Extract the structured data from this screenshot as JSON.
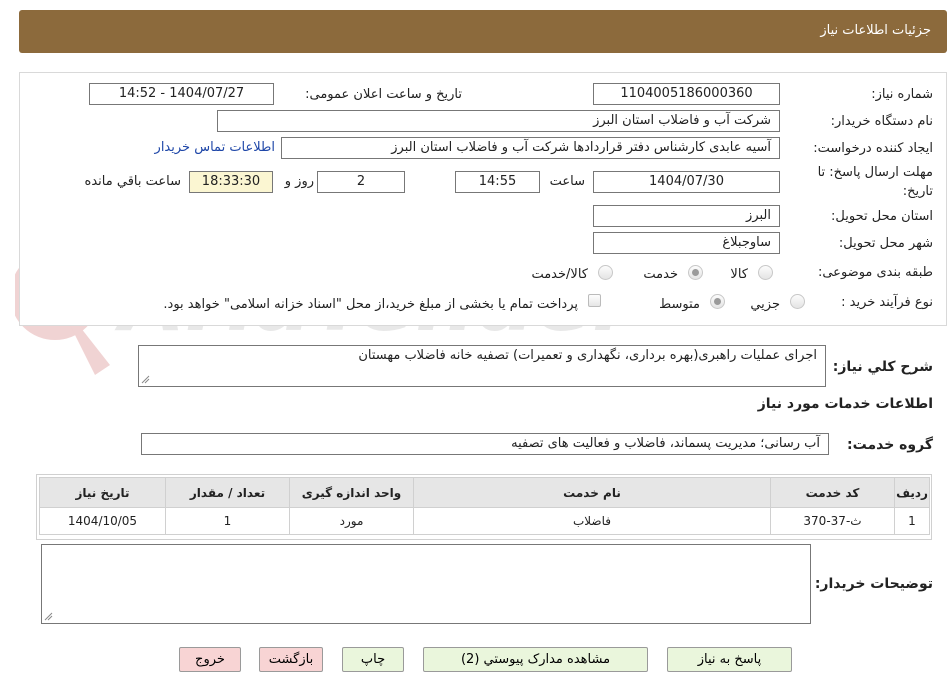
{
  "header": {
    "title": "جزئیات اطلاعات نیاز"
  },
  "need_number": {
    "label": "شماره نیاز:",
    "value": "1104005186000360"
  },
  "announce_datetime": {
    "label": "تاریخ و ساعت اعلان عمومی:",
    "value": "1404/07/27 - 14:52"
  },
  "buyer_org": {
    "label": "نام دستگاه خریدار:",
    "value": "شرکت آب و فاضلاب استان البرز"
  },
  "requester": {
    "label": "ایجاد کننده درخواست:",
    "value": "آسیه عابدی کارشناس دفتر قراردادها شرکت آب و فاضلاب استان البرز",
    "contact_link": "اطلاعات تماس خریدار"
  },
  "deadline": {
    "label_line1": "مهلت ارسال پاسخ: تا",
    "label_line2": "تاریخ:",
    "date": "1404/07/30",
    "time_label": "ساعت",
    "time": "14:55",
    "days": "2",
    "days_label": "روز و",
    "remaining": "18:33:30",
    "remaining_label": "ساعت باقي مانده"
  },
  "delivery_province": {
    "label": "استان محل تحویل:",
    "value": "البرز"
  },
  "delivery_city": {
    "label": "شهر محل تحویل:",
    "value": "ساوجبلاغ"
  },
  "category": {
    "label": "طبقه بندی موضوعی:",
    "options": [
      "کالا",
      "خدمت",
      "کالا/خدمت"
    ],
    "selected": "خدمت"
  },
  "purchase_process": {
    "label": "نوع فرآیند خرید :",
    "options": [
      "جزیي",
      "متوسط"
    ],
    "selected": "متوسط",
    "treasury_note": "پرداخت تمام یا بخشی از مبلغ خرید،از محل \"اسناد خزانه اسلامی\" خواهد بود."
  },
  "description": {
    "label": "شرح كلي نياز:",
    "value": "اجرای عملیات راهبری(بهره برداری، نگهداری و تعمیرات) تصفیه خانه فاضلاب مهستان"
  },
  "services_section": {
    "title": "اطلاعات خدمات مورد نياز"
  },
  "service_group": {
    "label": "گروه خدمت:",
    "value": "آب رسانی؛ مدیریت پسماند، فاضلاب و فعالیت های تصفیه"
  },
  "table": {
    "columns": [
      "ردیف",
      "کد خدمت",
      "نام خدمت",
      "واحد اندازه گیری",
      "تعداد / مقدار",
      "تاریخ نیاز"
    ],
    "rows": [
      [
        "1",
        "ث-37-370",
        "فاضلاب",
        "مورد",
        "1",
        "1404/10/05"
      ]
    ]
  },
  "buyer_notes": {
    "label": "توضیحات خریدار:",
    "value": ""
  },
  "buttons": {
    "reply": "پاسخ به نیاز",
    "attachments": "مشاهده مدارک پیوستي (2)",
    "print": "چاپ",
    "back": "بازگشت",
    "exit": "خروج"
  },
  "colors": {
    "header_bg": "#8c6a3c",
    "link": "#1f47a8",
    "remaining_bg": "#fbf6d2",
    "green_button": "#eaf6dc",
    "pink_button": "#f8d4d4"
  }
}
